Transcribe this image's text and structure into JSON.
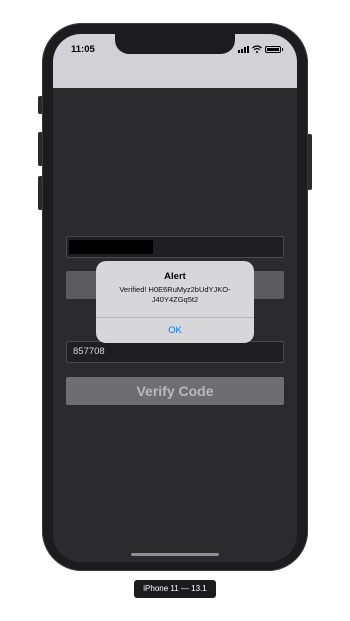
{
  "status_bar": {
    "time": "11:05",
    "icons": [
      "signal-icon",
      "wifi-icon",
      "battery-icon"
    ]
  },
  "form": {
    "verification_code_value": "857708",
    "verify_button_label": "Verify Code"
  },
  "alert": {
    "title": "Alert",
    "message": "Verified! H0E6RuMyz2bUdYJKO-J40Y4ZGq5t2",
    "ok_label": "OK"
  },
  "device_label": "iPhone 11 — 13.1",
  "colors": {
    "alert_button": "#0a7aff",
    "screen_background": "#2b2b2d",
    "status_bar": "#d1d1d6"
  }
}
